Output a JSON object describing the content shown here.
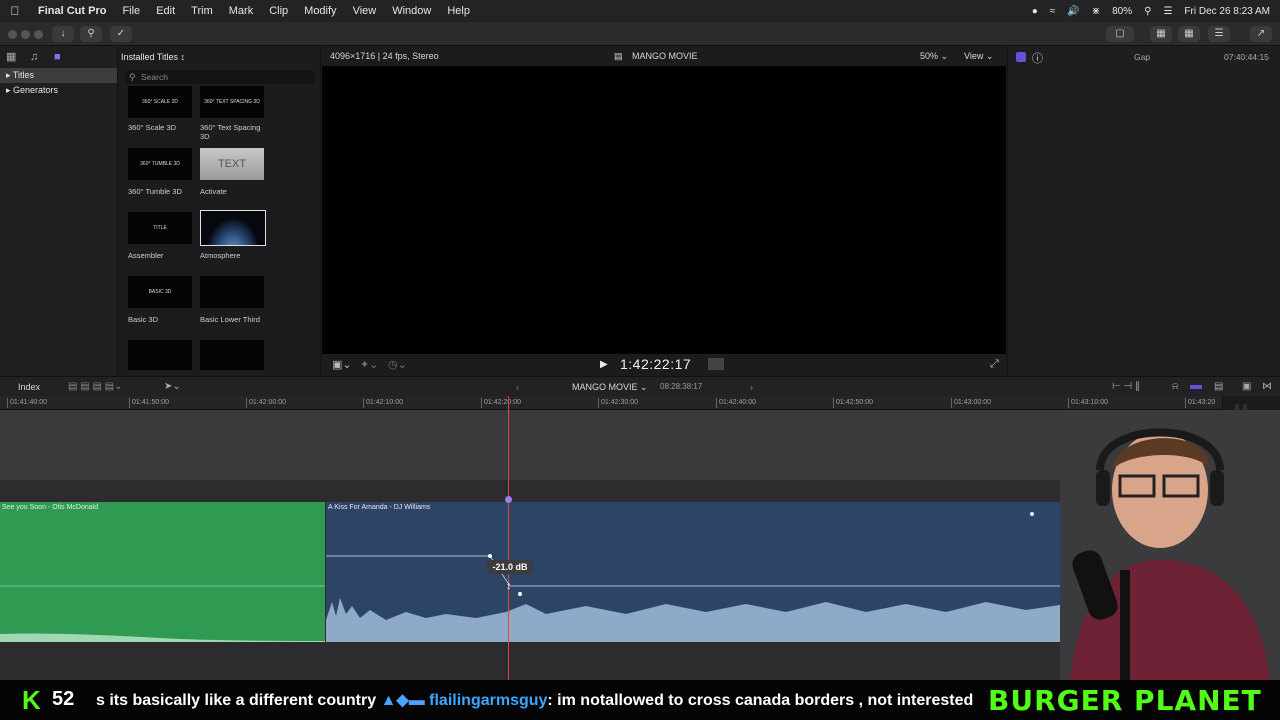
{
  "menubar": {
    "app_name": "Final Cut Pro",
    "items": [
      "File",
      "Edit",
      "Trim",
      "Mark",
      "Clip",
      "Modify",
      "View",
      "Window",
      "Help"
    ],
    "battery": "80%",
    "datetime": "Fri Dec 26  8:23 AM"
  },
  "sidebar": {
    "items": [
      {
        "label": "Titles",
        "selected": true
      },
      {
        "label": "Generators",
        "selected": false
      }
    ]
  },
  "browser": {
    "header": "Installed Titles",
    "search_placeholder": "Search",
    "items": [
      {
        "label": "360° Scale 3D",
        "thumb": "360° SCALE 3D"
      },
      {
        "label": "360° Text Spacing 3D",
        "thumb": "360° TEXT SPACING 3D"
      },
      {
        "label": "360° Tumble 3D",
        "thumb": "360° TUMBLE 3D"
      },
      {
        "label": "Activate",
        "thumb": "TEXT"
      },
      {
        "label": "Assembler",
        "thumb": "TITLE"
      },
      {
        "label": "Atmosphere",
        "thumb": ""
      },
      {
        "label": "Basic 3D",
        "thumb": "BASIC 3D"
      },
      {
        "label": "Basic Lower Third",
        "thumb": ""
      }
    ]
  },
  "viewer": {
    "format": "4096×1716 | 24 fps, Stereo",
    "project": "MANGO MOVIE",
    "zoom": "50%",
    "view_label": "View",
    "timecode": "1:42:22:17"
  },
  "inspector": {
    "clip": "Gap",
    "duration": "07:40:44:15"
  },
  "timeline": {
    "index_label": "Index",
    "project": "MANGO MOVIE",
    "total": "08:28:38:17",
    "ticks": [
      "01:41:40:00",
      "01:41:50:00",
      "01:42:00:00",
      "01:42:10:00",
      "01:42:20:00",
      "01:42:30:00",
      "01:42:40:00",
      "01:42:50:00",
      "01:43:00:00",
      "01:43:10:00",
      "01:43:20"
    ],
    "clips": [
      {
        "name": "See you Soon - Otis McDonald"
      },
      {
        "name": "A Kiss For Amanda - DJ Williams"
      }
    ],
    "volume_badge": "-21.0 dB"
  },
  "overlay": {
    "k": "K",
    "count": "52",
    "ticker_prefix": "s its basically like a different country",
    "username": "flailingarmsguy",
    "ticker_msg": ": im notallowed to cross canada borders , not interested",
    "brand": "BURGER PLANET"
  }
}
